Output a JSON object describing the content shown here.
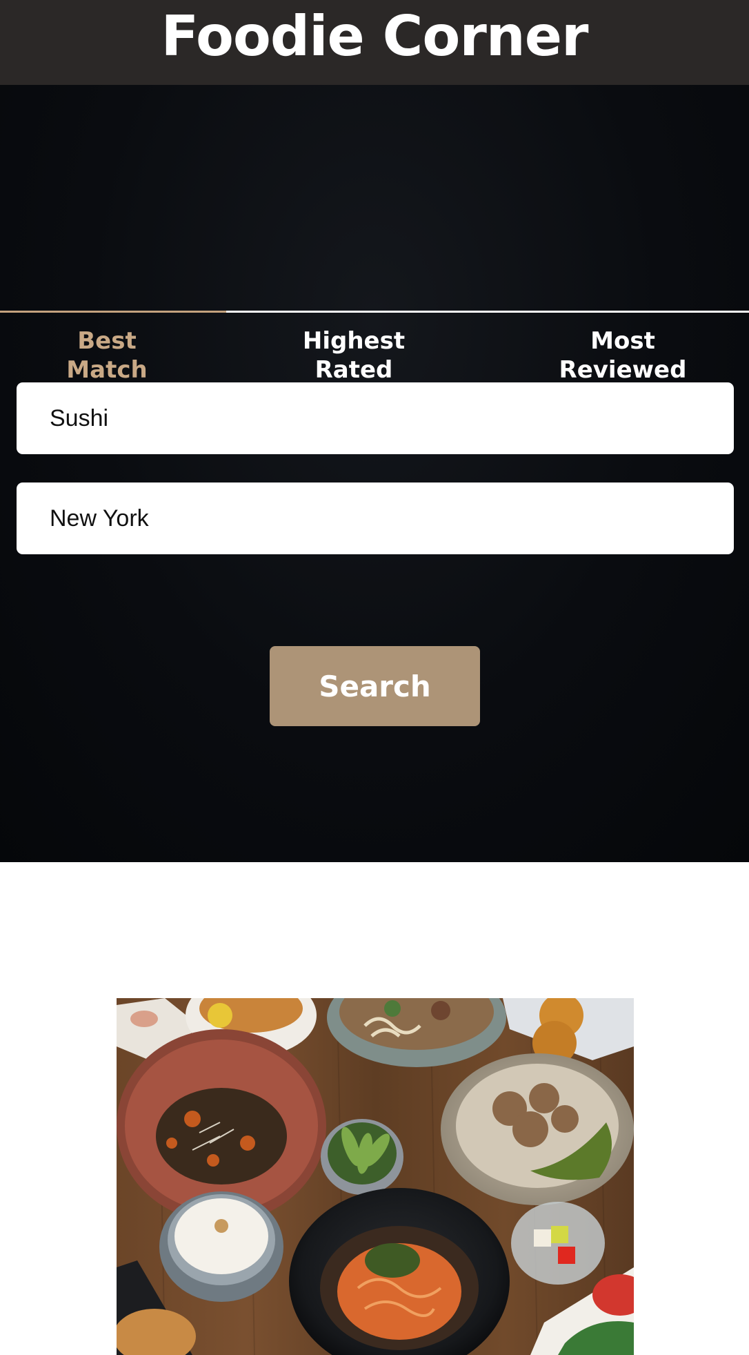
{
  "header": {
    "title": "Foodie Corner"
  },
  "tabs": [
    {
      "label": "Best Match",
      "line1": "Best",
      "line2": "Match",
      "active": true
    },
    {
      "label": "Highest Rated",
      "line1": "Highest",
      "line2": "Rated",
      "active": false
    },
    {
      "label": "Most Reviewed",
      "line1": "Most",
      "line2": "Reviewed",
      "active": false
    }
  ],
  "search": {
    "term_value": "Sushi",
    "location_value": "New York",
    "button_label": "Search"
  },
  "colors": {
    "header_bg": "#2b2827",
    "accent": "#c4a27e",
    "button_bg": "#ad9477",
    "hero_bg": "#0a0c10"
  }
}
